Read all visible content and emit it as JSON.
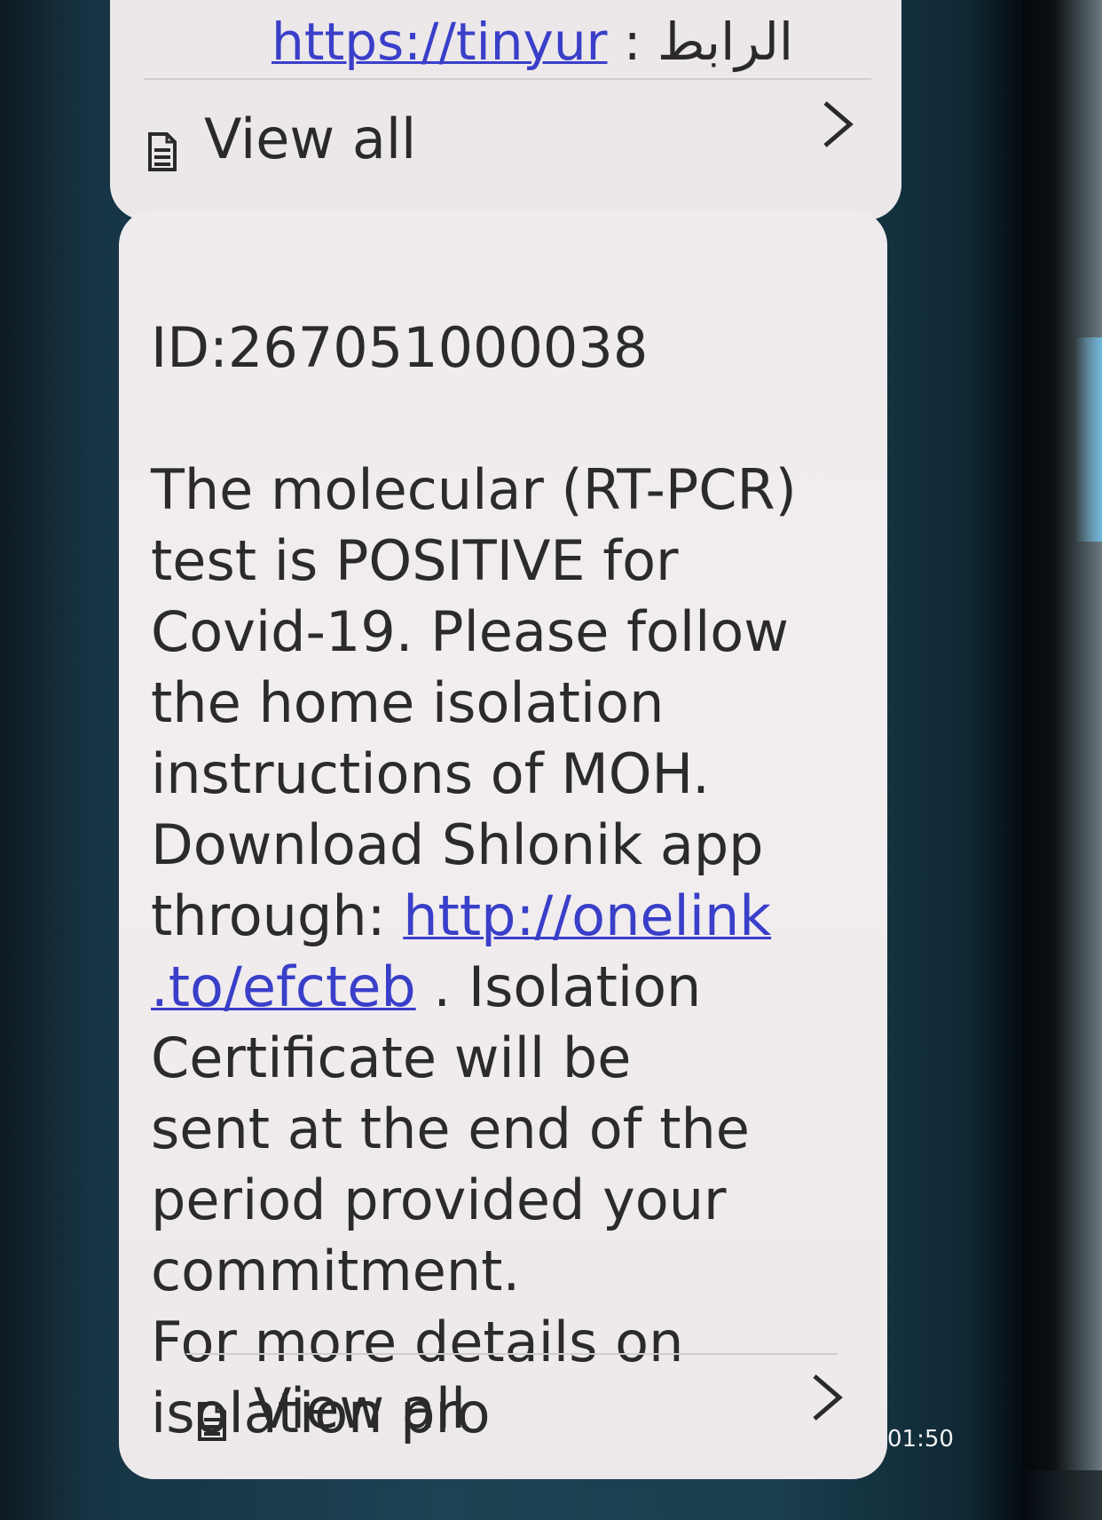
{
  "previous_message": {
    "link_text": "https://tinyur",
    "label_separator": " : ",
    "label_arabic": "الرابط",
    "view_all_label": "View all"
  },
  "message": {
    "id_line": "ID:267051000038",
    "body_before_link": "The molecular (RT-PCR)\ntest is POSITIVE for\nCovid-19. Please follow\nthe home isolation\ninstructions of MOH.\nDownload Shlonik app\nthrough: ",
    "link_text": "http://onelink\n.to/efcteb",
    "body_after_link": " . Isolation\nCertificate will be\nsent at the end of the\nperiod provided your\ncommitment.\nFor more details on\nisolation pro",
    "view_all_label": "View all",
    "timestamp": "01:50"
  },
  "icons": {
    "document": "document-icon",
    "chevron": "chevron-right-icon"
  }
}
